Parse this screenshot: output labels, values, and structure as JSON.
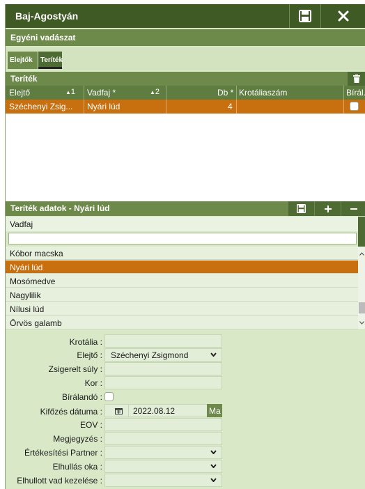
{
  "window": {
    "title": "Baj-Agostyán",
    "subtitle": "Egyéni vadászat"
  },
  "tabs": [
    {
      "label": "Elejtők"
    },
    {
      "label": "Teríték"
    }
  ],
  "teritek": {
    "section_title": "Teríték",
    "columns": {
      "elejto": "Elejtő",
      "elejto_sort": "1",
      "vadfaj": "Vadfaj *",
      "vadfaj_sort": "2",
      "db": "Db *",
      "krotalia": "Krotáliaszám",
      "biral": "Bírál..."
    },
    "row": {
      "elejto": "Széchenyi Zsig...",
      "vadfaj": "Nyári lúd",
      "db": "4"
    }
  },
  "details": {
    "section_title": "Teríték adatok - Nyári lúd",
    "vadfaj_label": "Vadfaj",
    "vadfaj_search": "",
    "vadfaj_list": [
      "Kóbor macska",
      "Nyári lúd",
      "Mosómedve",
      "Nagylilik",
      "Nílusi lúd",
      "Örvös galamb"
    ],
    "selected_index": 1
  },
  "form": {
    "krotalia_label": "Krotália :",
    "krotalia_value": "",
    "elejto_label": "Elejtő :",
    "elejto_value": "Széchenyi Zsigmond",
    "suly_label": "Zsigerelt súly :",
    "kor_label": "Kor :",
    "biralando_label": "Bírálandó :",
    "kifozes_label": "Kifőzés dátuma :",
    "kifozes_value": "2022.08.12",
    "today_button": "Ma",
    "eov_label": "EOV :",
    "megjegyzes_label": "Megjegyzés :",
    "partner_label": "Értékesítési Partner :",
    "elhullas_label": "Elhullás oka :",
    "kezeles_label": "Elhullott vad kezelése :"
  },
  "colors": {
    "titlebar": "#3f5a25",
    "accent": "#6d8a4b",
    "selection": "#c87010",
    "panel": "#d9e9c8"
  }
}
